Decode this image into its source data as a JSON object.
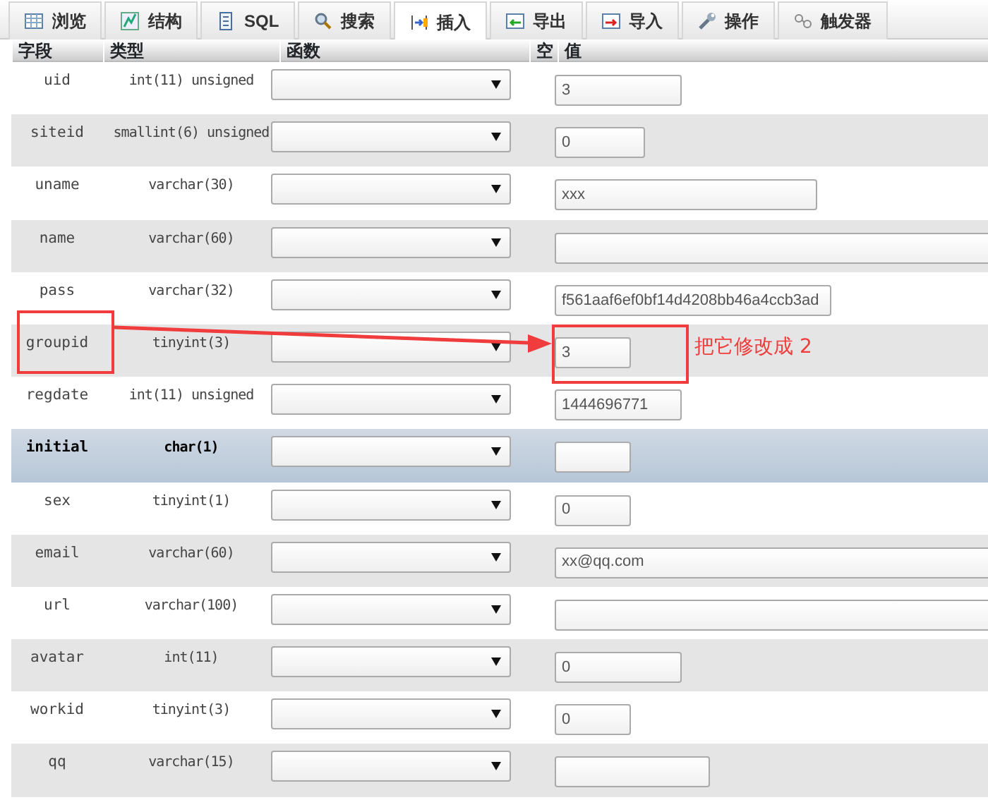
{
  "tabs": [
    {
      "label": "浏览",
      "selected": false
    },
    {
      "label": "结构",
      "selected": false
    },
    {
      "label": "SQL",
      "selected": false
    },
    {
      "label": "搜索",
      "selected": false
    },
    {
      "label": "插入",
      "selected": true
    },
    {
      "label": "导出",
      "selected": false
    },
    {
      "label": "导入",
      "selected": false
    },
    {
      "label": "操作",
      "selected": false
    },
    {
      "label": "触发器",
      "selected": false
    }
  ],
  "table": {
    "columns": [
      "字段",
      "类型",
      "函数",
      "空",
      "值"
    ],
    "rows": [
      {
        "field": "uid",
        "type": "int(11) unsigned",
        "value": "3",
        "kind": "medium",
        "highlighted": false
      },
      {
        "field": "siteid",
        "type": "smallint(6) unsigned",
        "value": "0",
        "kind": "small",
        "highlighted": false
      },
      {
        "field": "uname",
        "type": "varchar(30)",
        "value": "xxx",
        "kind": "long",
        "highlighted": false
      },
      {
        "field": "name",
        "type": "varchar(60)",
        "kind": "wide",
        "highlighted": false
      },
      {
        "field": "pass",
        "type": "varchar(32)",
        "value": "f561aaf6ef0bf14d4208bb46a4ccb3ad",
        "kind": "longer",
        "highlighted": false
      },
      {
        "field": "groupid",
        "type": "tinyint(3)",
        "value": "3",
        "kind": "tiny",
        "highlighted": false
      },
      {
        "field": "regdate",
        "type": "int(11) unsigned",
        "value": "1444696771",
        "kind": "medium",
        "highlighted": false
      },
      {
        "field": "initial",
        "type": "char(1)",
        "kind": "tiny",
        "highlighted": true
      },
      {
        "field": "sex",
        "type": "tinyint(1)",
        "value": "0",
        "kind": "tiny",
        "highlighted": false
      },
      {
        "field": "email",
        "type": "varchar(60)",
        "value": "xx@qq.com",
        "kind": "wide",
        "highlighted": false
      },
      {
        "field": "url",
        "type": "varchar(100)",
        "kind": "wide",
        "highlighted": false
      },
      {
        "field": "avatar",
        "type": "int(11)",
        "value": "0",
        "kind": "medium",
        "highlighted": false
      },
      {
        "field": "workid",
        "type": "tinyint(3)",
        "value": "0",
        "kind": "tiny",
        "highlighted": false
      },
      {
        "field": "qq",
        "type": "varchar(15)",
        "kind": "mediumlong",
        "highlighted": false
      }
    ]
  },
  "annotation": {
    "text": "把它修改成 2"
  }
}
